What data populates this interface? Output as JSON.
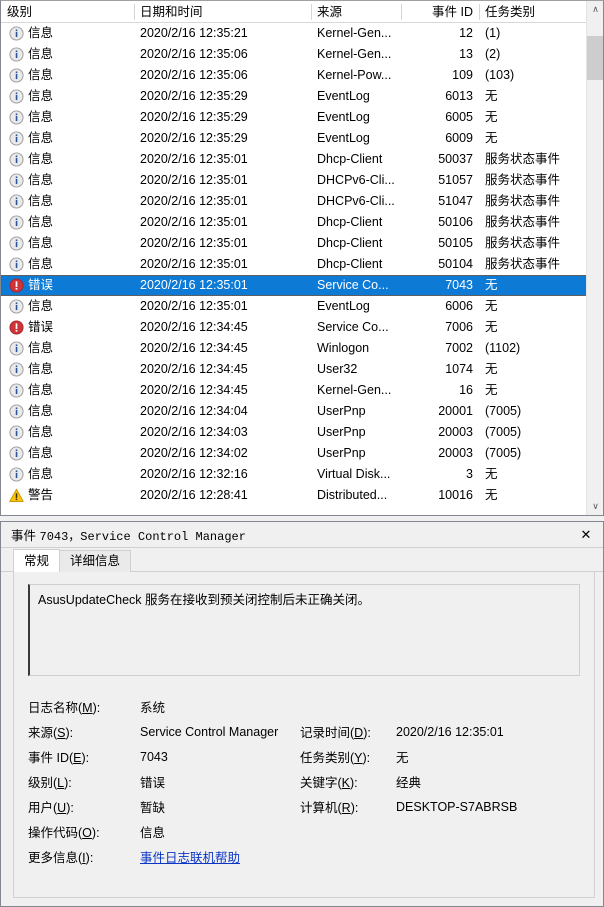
{
  "list": {
    "columns": [
      {
        "label": "级别",
        "key": "level"
      },
      {
        "label": "日期和时间",
        "key": "date"
      },
      {
        "label": "来源",
        "key": "source"
      },
      {
        "label": "事件 ID",
        "key": "eid"
      },
      {
        "label": "任务类别",
        "key": "task"
      }
    ],
    "rows": [
      {
        "icon": "information-icon",
        "level": "信息",
        "date": "2020/2/16 12:35:21",
        "source": "Kernel-Gen...",
        "eid": "12",
        "task": "(1)",
        "selected": false
      },
      {
        "icon": "information-icon",
        "level": "信息",
        "date": "2020/2/16 12:35:06",
        "source": "Kernel-Gen...",
        "eid": "13",
        "task": "(2)",
        "selected": false
      },
      {
        "icon": "information-icon",
        "level": "信息",
        "date": "2020/2/16 12:35:06",
        "source": "Kernel-Pow...",
        "eid": "109",
        "task": "(103)",
        "selected": false
      },
      {
        "icon": "information-icon",
        "level": "信息",
        "date": "2020/2/16 12:35:29",
        "source": "EventLog",
        "eid": "6013",
        "task": "无",
        "selected": false
      },
      {
        "icon": "information-icon",
        "level": "信息",
        "date": "2020/2/16 12:35:29",
        "source": "EventLog",
        "eid": "6005",
        "task": "无",
        "selected": false
      },
      {
        "icon": "information-icon",
        "level": "信息",
        "date": "2020/2/16 12:35:29",
        "source": "EventLog",
        "eid": "6009",
        "task": "无",
        "selected": false
      },
      {
        "icon": "information-icon",
        "level": "信息",
        "date": "2020/2/16 12:35:01",
        "source": "Dhcp-Client",
        "eid": "50037",
        "task": "服务状态事件",
        "selected": false
      },
      {
        "icon": "information-icon",
        "level": "信息",
        "date": "2020/2/16 12:35:01",
        "source": "DHCPv6-Cli...",
        "eid": "51057",
        "task": "服务状态事件",
        "selected": false
      },
      {
        "icon": "information-icon",
        "level": "信息",
        "date": "2020/2/16 12:35:01",
        "source": "DHCPv6-Cli...",
        "eid": "51047",
        "task": "服务状态事件",
        "selected": false
      },
      {
        "icon": "information-icon",
        "level": "信息",
        "date": "2020/2/16 12:35:01",
        "source": "Dhcp-Client",
        "eid": "50106",
        "task": "服务状态事件",
        "selected": false
      },
      {
        "icon": "information-icon",
        "level": "信息",
        "date": "2020/2/16 12:35:01",
        "source": "Dhcp-Client",
        "eid": "50105",
        "task": "服务状态事件",
        "selected": false
      },
      {
        "icon": "information-icon",
        "level": "信息",
        "date": "2020/2/16 12:35:01",
        "source": "Dhcp-Client",
        "eid": "50104",
        "task": "服务状态事件",
        "selected": false
      },
      {
        "icon": "error-icon",
        "level": "错误",
        "date": "2020/2/16 12:35:01",
        "source": "Service Co...",
        "eid": "7043",
        "task": "无",
        "selected": true
      },
      {
        "icon": "information-icon",
        "level": "信息",
        "date": "2020/2/16 12:35:01",
        "source": "EventLog",
        "eid": "6006",
        "task": "无",
        "selected": false
      },
      {
        "icon": "error-icon",
        "level": "错误",
        "date": "2020/2/16 12:34:45",
        "source": "Service Co...",
        "eid": "7006",
        "task": "无",
        "selected": false
      },
      {
        "icon": "information-icon",
        "level": "信息",
        "date": "2020/2/16 12:34:45",
        "source": "Winlogon",
        "eid": "7002",
        "task": "(1102)",
        "selected": false
      },
      {
        "icon": "information-icon",
        "level": "信息",
        "date": "2020/2/16 12:34:45",
        "source": "User32",
        "eid": "1074",
        "task": "无",
        "selected": false
      },
      {
        "icon": "information-icon",
        "level": "信息",
        "date": "2020/2/16 12:34:45",
        "source": "Kernel-Gen...",
        "eid": "16",
        "task": "无",
        "selected": false
      },
      {
        "icon": "information-icon",
        "level": "信息",
        "date": "2020/2/16 12:34:04",
        "source": "UserPnp",
        "eid": "20001",
        "task": "(7005)",
        "selected": false
      },
      {
        "icon": "information-icon",
        "level": "信息",
        "date": "2020/2/16 12:34:03",
        "source": "UserPnp",
        "eid": "20003",
        "task": "(7005)",
        "selected": false
      },
      {
        "icon": "information-icon",
        "level": "信息",
        "date": "2020/2/16 12:34:02",
        "source": "UserPnp",
        "eid": "20003",
        "task": "(7005)",
        "selected": false
      },
      {
        "icon": "information-icon",
        "level": "信息",
        "date": "2020/2/16 12:32:16",
        "source": "Virtual Disk...",
        "eid": "3",
        "task": "无",
        "selected": false
      },
      {
        "icon": "warning-icon",
        "level": "警告",
        "date": "2020/2/16 12:28:41",
        "source": "Distributed...",
        "eid": "10016",
        "task": "无",
        "selected": false
      }
    ],
    "scrollbar": {
      "up_glyph": "∧",
      "down_glyph": "∨"
    }
  },
  "detail": {
    "title_prefix": "事件",
    "title_mono": "7043，Service Control Manager",
    "close_label": "✕",
    "tabs": [
      {
        "label": "常规",
        "active": true
      },
      {
        "label": "详细信息",
        "active": false
      }
    ],
    "message": "AsusUpdateCheck 服务在接收到预关闭控制后未正确关闭。",
    "fields": [
      {
        "label_pre": "日志名称(",
        "label_key": "M",
        "label_post": "):",
        "value": "系统",
        "label2_pre": "",
        "label2_key": "",
        "label2_post": "",
        "value2": ""
      },
      {
        "label_pre": "来源(",
        "label_key": "S",
        "label_post": "):",
        "value": "Service Control Manager",
        "label2_pre": "记录时间(",
        "label2_key": "D",
        "label2_post": "):",
        "value2": "2020/2/16 12:35:01"
      },
      {
        "label_pre": "事件 ID(",
        "label_key": "E",
        "label_post": "):",
        "value": "7043",
        "label2_pre": "任务类别(",
        "label2_key": "Y",
        "label2_post": "):",
        "value2": "无"
      },
      {
        "label_pre": "级别(",
        "label_key": "L",
        "label_post": "):",
        "value": "错误",
        "label2_pre": "关键字(",
        "label2_key": "K",
        "label2_post": "):",
        "value2": "经典"
      },
      {
        "label_pre": "用户(",
        "label_key": "U",
        "label_post": "):",
        "value": "暂缺",
        "label2_pre": "计算机(",
        "label2_key": "R",
        "label2_post": "):",
        "value2": "DESKTOP-S7ABRSB"
      },
      {
        "label_pre": "操作代码(",
        "label_key": "O",
        "label_post": "):",
        "value": "信息",
        "label2_pre": "",
        "label2_key": "",
        "label2_post": "",
        "value2": ""
      }
    ],
    "more_info": {
      "label_pre": "更多信息(",
      "label_key": "I",
      "label_post": "):",
      "link": "事件日志联机帮助"
    }
  },
  "colors": {
    "selection": "#0d7ad6",
    "error": "#d13438",
    "warning": "#ffc40a",
    "info": "#2a5699",
    "link": "#0b36c4"
  }
}
